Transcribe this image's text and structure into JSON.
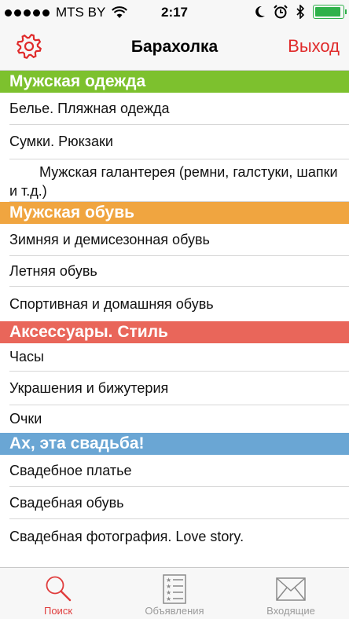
{
  "status_bar": {
    "carrier": "MTS BY",
    "time": "2:17",
    "battery_level": 0.95,
    "battery_color": "#2fb14a"
  },
  "nav": {
    "title": "Барахолка",
    "logout_label": "Выход",
    "settings_icon": "gear-icon",
    "accent_color": "#e02b2b"
  },
  "sections": [
    {
      "title": "Мужская одежда",
      "color": "#7dc12e",
      "items": [
        "Белье. Пляжная одежда",
        "Сумки. Рюкзаки",
        "Мужская галантерея (ремни, галстуки, шапки и т.д.)"
      ]
    },
    {
      "title": "Мужская обувь",
      "color": "#f0a540",
      "items": [
        "Зимняя и демисезонная обувь",
        "Летняя обувь",
        "Спортивная и домашняя обувь"
      ]
    },
    {
      "title": "Аксессуары. Стиль",
      "color": "#e9665a",
      "items": [
        "Часы",
        "Украшения и бижутерия",
        "Очки"
      ]
    },
    {
      "title": "Ах, эта свадьба!",
      "color": "#6aa6d4",
      "items": [
        "Свадебное платье",
        "Свадебная обувь",
        "Свадебная фотография. Love story."
      ]
    }
  ],
  "tabs": [
    {
      "label": "Поиск",
      "icon": "search-icon",
      "active": true
    },
    {
      "label": "Объявления",
      "icon": "list-icon",
      "active": false
    },
    {
      "label": "Входящие",
      "icon": "envelope-icon",
      "active": false
    }
  ]
}
